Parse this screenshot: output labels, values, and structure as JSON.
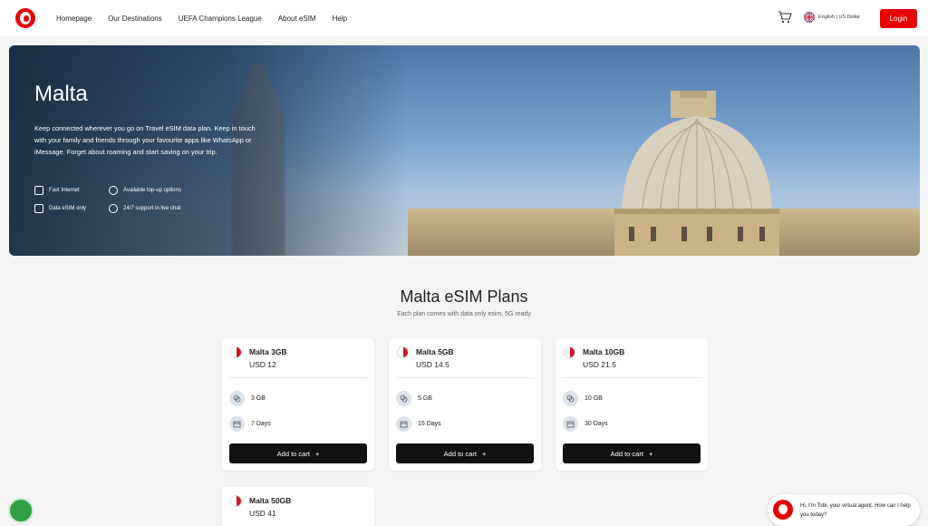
{
  "header": {
    "nav": [
      "Homepage",
      "Our Destinations",
      "UEFA Champions League",
      "About eSIM",
      "Help"
    ],
    "language": "English | US Dollar",
    "login_label": "Login"
  },
  "hero": {
    "title": "Malta",
    "description": "Keep connected wherever you go on Travel eSIM data plan. Keep in touch with your family and friends through your favourite apps like WhatsApp or iMessage. Forget about roaming and start saving on your trip.",
    "features": [
      "Fast Internet",
      "Available top-up options",
      "Data eSIM only",
      "24/7 support in live chat"
    ]
  },
  "plans": {
    "title": "Malta eSIM Plans",
    "subtitle": "Each plan comes with data only esim, 5G ready",
    "add_label": "Add to cart",
    "items": [
      {
        "name": "Malta 3GB",
        "price": "USD 12",
        "data": "3 GB",
        "days": "7 Days"
      },
      {
        "name": "Malta 5GB",
        "price": "USD 14.5",
        "data": "5 GB",
        "days": "15 Days"
      },
      {
        "name": "Malta 10GB",
        "price": "USD 21.5",
        "data": "10 GB",
        "days": "30 Days"
      },
      {
        "name": "Malta 50GB",
        "price": "USD 41"
      }
    ]
  },
  "chat": {
    "message": "Hi, I'm Tobi, your virtual agent. How can I help you today?"
  },
  "colors": {
    "brand": "#e60000",
    "button_dark": "#111111"
  }
}
